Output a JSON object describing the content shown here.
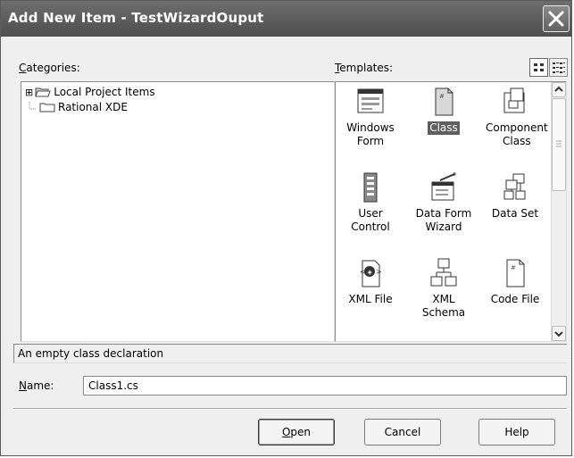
{
  "window": {
    "title": "Add New Item - TestWizardOuput"
  },
  "categories": {
    "label_prefix": "C",
    "label_rest": "ategories:",
    "items": [
      {
        "label": "Local Project Items",
        "expander": "⊞",
        "icon": "folder-open-icon"
      },
      {
        "label": "Rational XDE",
        "icon": "folder-icon"
      }
    ]
  },
  "templates": {
    "label_prefix": "T",
    "label_rest": "emplates:",
    "view_buttons": [
      "large-icons-view-icon",
      "small-icons-view-icon"
    ],
    "items": [
      {
        "line1": "Windows",
        "line2": "Form",
        "icon": "windows-form-icon",
        "selected": false
      },
      {
        "line1": "Class",
        "line2": "",
        "icon": "class-file-icon",
        "selected": true
      },
      {
        "line1": "Component",
        "line2": "Class",
        "icon": "component-class-icon",
        "selected": false
      },
      {
        "line1": "User Control",
        "line2": "",
        "icon": "user-control-icon",
        "selected": false
      },
      {
        "line1": "Data Form",
        "line2": "Wizard",
        "icon": "data-form-wizard-icon",
        "selected": false
      },
      {
        "line1": "Data Set",
        "line2": "",
        "icon": "data-set-icon",
        "selected": false
      },
      {
        "line1": "XML File",
        "line2": "",
        "icon": "xml-file-icon",
        "selected": false
      },
      {
        "line1": "XML",
        "line2": "Schema",
        "icon": "xml-schema-icon",
        "selected": false
      },
      {
        "line1": "Code File",
        "line2": "",
        "icon": "code-file-icon",
        "selected": false
      }
    ]
  },
  "description": "An empty class declaration",
  "name_field": {
    "label_prefix": "N",
    "label_rest": "ame:",
    "value": "Class1.cs"
  },
  "buttons": {
    "open_prefix": "O",
    "open_rest": "pen",
    "cancel": "Cancel",
    "help": "Help"
  },
  "colors": {
    "titlebar": "#5a5a5a",
    "selection": "#5f5f5f",
    "dialog_bg": "#efefef"
  }
}
